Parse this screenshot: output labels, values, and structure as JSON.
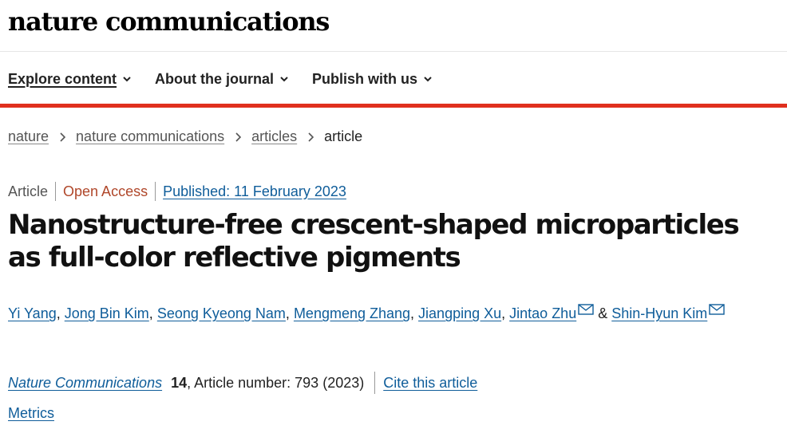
{
  "site": {
    "logo": "nature communications"
  },
  "nav": {
    "items": [
      {
        "label": "Explore content"
      },
      {
        "label": "About the journal"
      },
      {
        "label": "Publish with us"
      }
    ]
  },
  "breadcrumb": {
    "items": [
      "nature",
      "nature communications",
      "articles"
    ],
    "current": "article"
  },
  "article": {
    "type": "Article",
    "access": "Open Access",
    "published": "Published: 11 February 2023",
    "title": "Nanostructure-free crescent-shaped microparticles as full-color reflective pigments",
    "authors": [
      "Yi Yang",
      "Jong Bin Kim",
      "Seong Kyeong Nam",
      "Mengmeng Zhang",
      "Jiangping Xu",
      "Jintao Zhu",
      "Shin-Hyun Kim"
    ],
    "separator": ", ",
    "ampersand": " & ",
    "journal": "Nature Communications",
    "volume": "14",
    "article_number": ", Article number: 793 (2023)",
    "cite_label": "Cite this article",
    "metrics_label": "Metrics"
  },
  "colors": {
    "accent_bar": "#e0301e",
    "link": "#0f5d9a",
    "open_access": "#b0472a"
  },
  "icons": {
    "dropdown": "chevron-down-icon",
    "breadcrumb_sep": "chevron-right-icon",
    "contact": "envelope-icon"
  }
}
